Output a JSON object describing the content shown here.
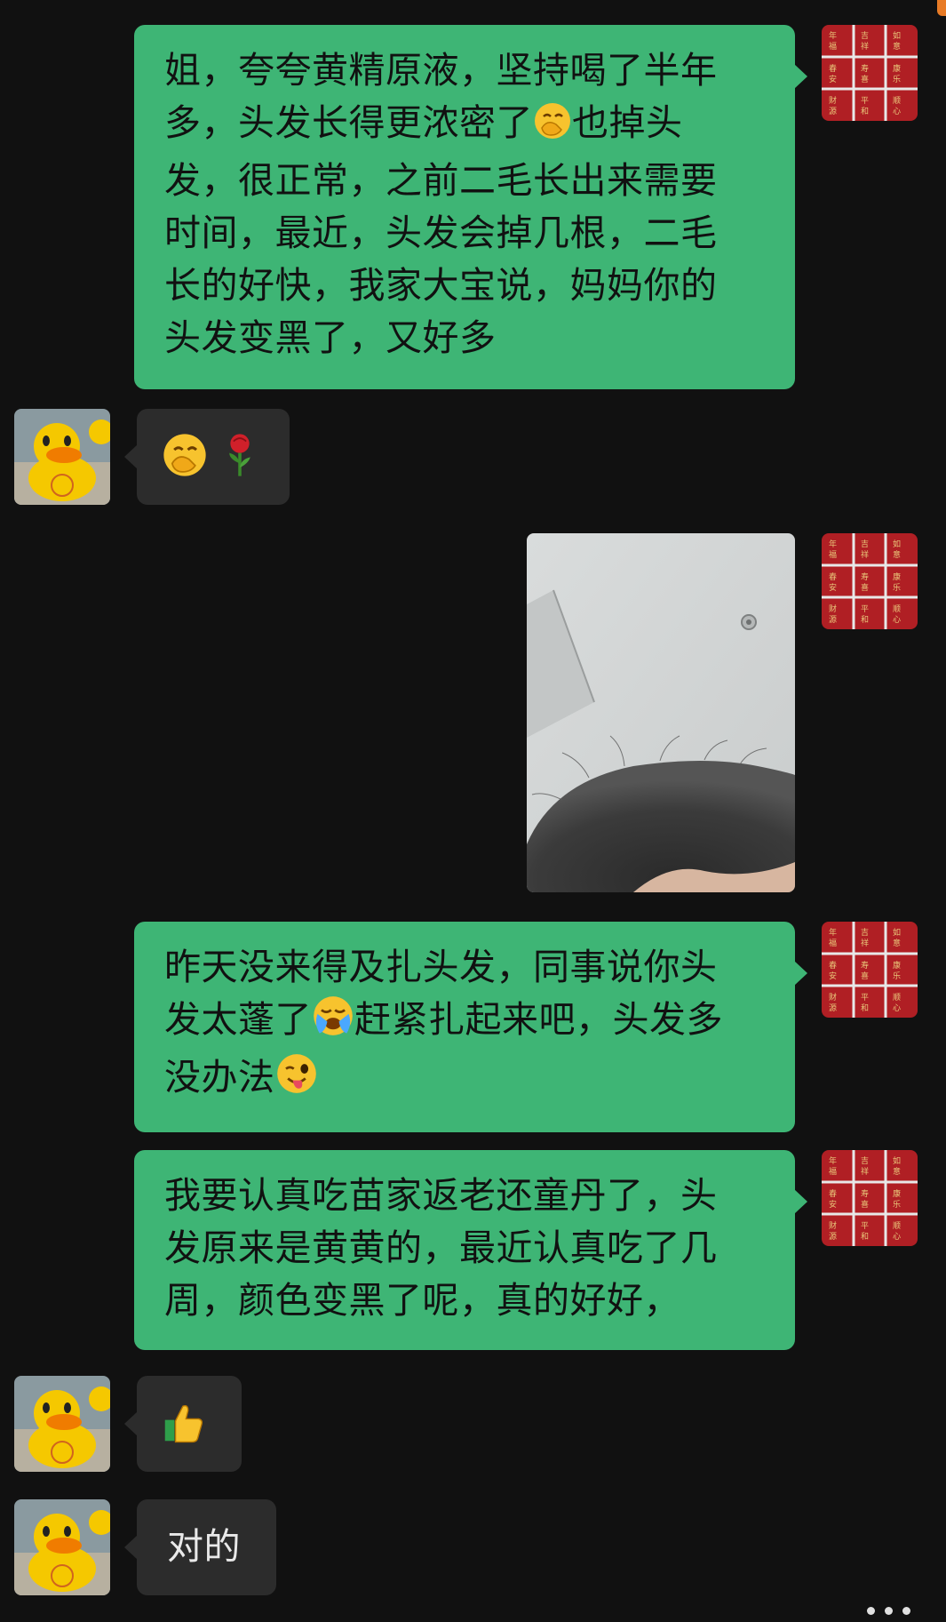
{
  "messages": [
    {
      "sender": "self",
      "type": "text",
      "lines": [
        "姐，夸夸黄精原液，坚持喝了半年",
        "多，头发长得更浓密了",
        "发，很正常，之前二毛长出来需要",
        "时间，最近，头发会掉几根，二毛",
        "长的好快，我家大宝说，妈妈你的",
        "头发变黑了，又好多"
      ],
      "line2_tail": "也掉头",
      "emoji_names": [
        "face-with-hand-over-mouth"
      ]
    },
    {
      "sender": "other",
      "type": "emoji",
      "emoji_names": [
        "face-with-hand-over-mouth",
        "rose"
      ]
    },
    {
      "sender": "self",
      "type": "image",
      "image_name": "hairline-photo"
    },
    {
      "sender": "self",
      "type": "text",
      "line1": "昨天没来得及扎头发，同事说你头",
      "line2_head": "发太蓬了",
      "line2_tail": "赶紧扎起来吧，头发多",
      "line3_head": "没办法",
      "emoji_names": [
        "loudly-crying-face",
        "winking-face-with-tongue"
      ]
    },
    {
      "sender": "self",
      "type": "text",
      "lines": [
        "我要认真吃苗家返老还童丹了，头",
        "发原来是黄黄的，最近认真吃了几",
        "周，颜色变黑了呢，真的好好，"
      ]
    },
    {
      "sender": "other",
      "type": "emoji",
      "emoji_names": [
        "thumbs-up"
      ]
    },
    {
      "sender": "other",
      "type": "text",
      "text": "对的"
    }
  ],
  "avatars": {
    "self": {
      "name": "red-calligraphy-avatar",
      "colors": [
        "#b01f24",
        "#d8a24a"
      ]
    },
    "other": {
      "name": "yellow-duck-avatar",
      "colors": [
        "#f5c800",
        "#f07c00"
      ]
    }
  },
  "colors": {
    "background": "#111111",
    "self_bubble": "#3eb575",
    "other_bubble": "#2c2c2c"
  }
}
